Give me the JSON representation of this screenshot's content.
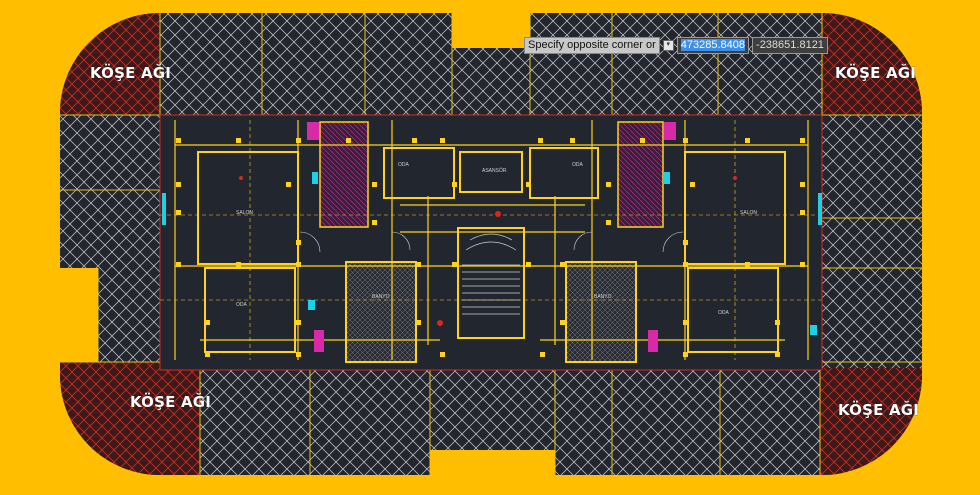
{
  "corner_labels": {
    "top_left": "KÖŞE AĞI",
    "top_right": "KÖŞE AĞI",
    "bottom_left": "KÖŞE AĞI",
    "bottom_right": "KÖŞE AĞI"
  },
  "command_line": {
    "prompt": "Specify opposite corner or",
    "x_value": "473285.8408",
    "y_value": "-238651.8121"
  },
  "colors": {
    "background": "#ffbf00",
    "canvas": "#22262f",
    "hatch": "#cfcfcf",
    "corner_hatch": "#d8281e",
    "walls": "#ffd21c",
    "cyan": "#19d2e8",
    "magenta": "#d82aa8"
  }
}
